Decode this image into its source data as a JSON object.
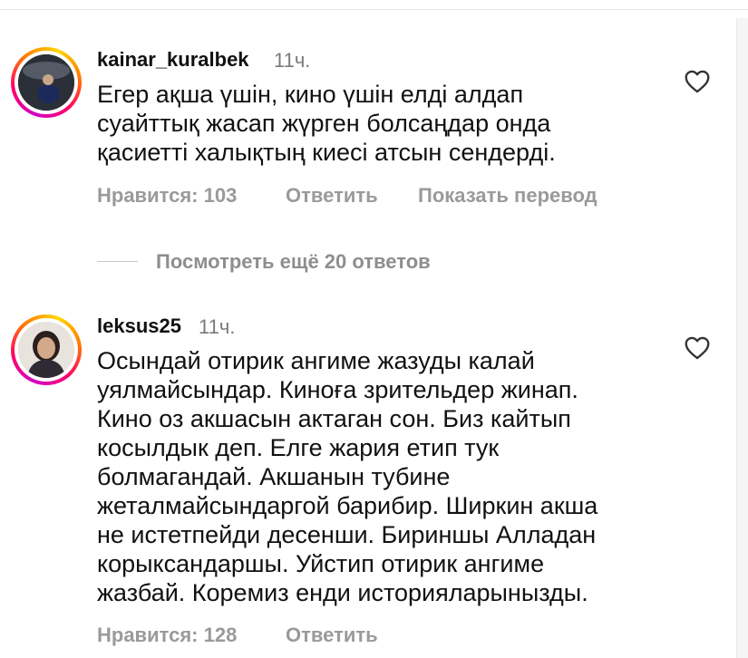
{
  "comments": [
    {
      "username": "kainar_kuralbek",
      "time": "11ч.",
      "text": "Егер ақша үшін, кино үшін елді алдап\nсуайттық жасап жүрген болсаңдар онда\nқасиетті халықтың киесі атсын сендерді.",
      "likes": "Нравится: 103",
      "reply": "Ответить",
      "translate": "Показать перевод"
    },
    {
      "username": "leksus25",
      "time": "11ч.",
      "text": "Осындай отирик ангиме жазуды калай\nуялмайсындар. Киноға зрительдер жинап.\nКино оз акшасын актаган сон. Биз кайтып\nкосылдык деп. Елге жария етип тук\nболмагандай. Акшанын тубине\nжеталмайсындаргой барибир. Ширкин акша\nне истетпейди десенши. Бириншы Алладан\nкорыксандаршы. Уйстип отирик ангиме\nжазбай. Коремиз енди историяларыныз­ды.",
      "likes": "Нравится: 128",
      "reply": "Ответить"
    }
  ],
  "view_more_replies": "Посмотреть ещё 20 ответов",
  "icons": {
    "like": "heart-icon"
  }
}
